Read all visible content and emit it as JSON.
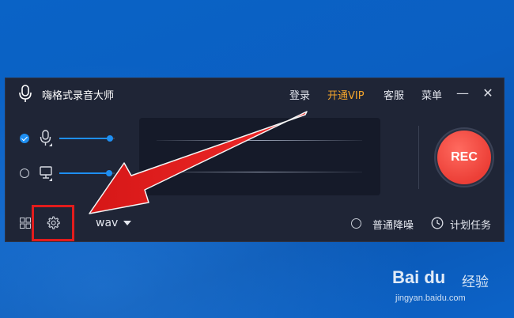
{
  "app": {
    "title": "嗨格式录音大师",
    "menu": {
      "login": "登录",
      "vip": "开通VIP",
      "service": "客服",
      "menu": "菜单"
    },
    "window_controls": {
      "minimize": "—",
      "close": "✕"
    }
  },
  "sources": [
    {
      "name": "microphone",
      "icon": "microphone-icon",
      "selected": true,
      "level": 0.92
    },
    {
      "name": "system-audio",
      "icon": "monitor-icon",
      "selected": false,
      "level": 0.9
    }
  ],
  "record_button": {
    "label": "REC",
    "color": "#ef4138"
  },
  "bottom_bar": {
    "format": "wav",
    "options": {
      "noise_reduction": "普通降噪",
      "scheduled_task": "计划任务"
    }
  },
  "colors": {
    "accent": "#1e8ff2",
    "vip": "#f4a52c",
    "highlight_box": "#e21c1c",
    "arrow": "#e21c1c"
  },
  "watermark": {
    "logo": "Bai du",
    "label": "经验",
    "url": "jingyan.baidu.com"
  }
}
